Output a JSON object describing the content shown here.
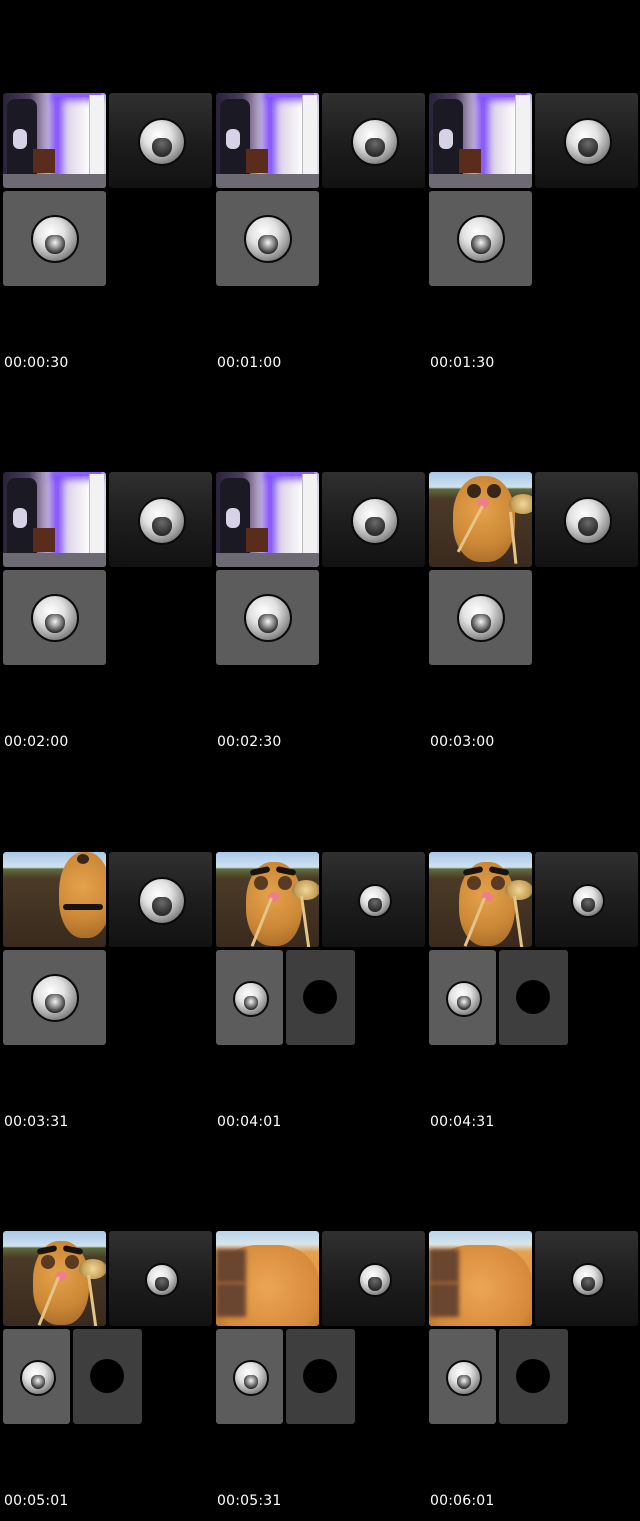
{
  "grid": [
    {
      "timestamp": "00:00:30",
      "layout": "room-dark-gray"
    },
    {
      "timestamp": "00:01:00",
      "layout": "room-dark-gray"
    },
    {
      "timestamp": "00:01:30",
      "layout": "room-dark-gray"
    },
    {
      "timestamp": "00:02:00",
      "layout": "room-dark-gray"
    },
    {
      "timestamp": "00:02:30",
      "layout": "room-dark-gray"
    },
    {
      "timestamp": "00:03:00",
      "layout": "potato-dark-gray"
    },
    {
      "timestamp": "00:03:31",
      "layout": "potato-side-dark-gray"
    },
    {
      "timestamp": "00:04:01",
      "layout": "potato-dark-four"
    },
    {
      "timestamp": "00:04:31",
      "layout": "potato-dark-four"
    },
    {
      "timestamp": "00:05:01",
      "layout": "potato-dark-four"
    },
    {
      "timestamp": "00:05:31",
      "layout": "closeup-dark-four"
    },
    {
      "timestamp": "00:06:01",
      "layout": "closeup-dark-four"
    }
  ],
  "colors": {
    "background": "#000000",
    "led": "#8c5cff",
    "potato": "#cc8836",
    "tile_gray": "#5c5c5c"
  }
}
